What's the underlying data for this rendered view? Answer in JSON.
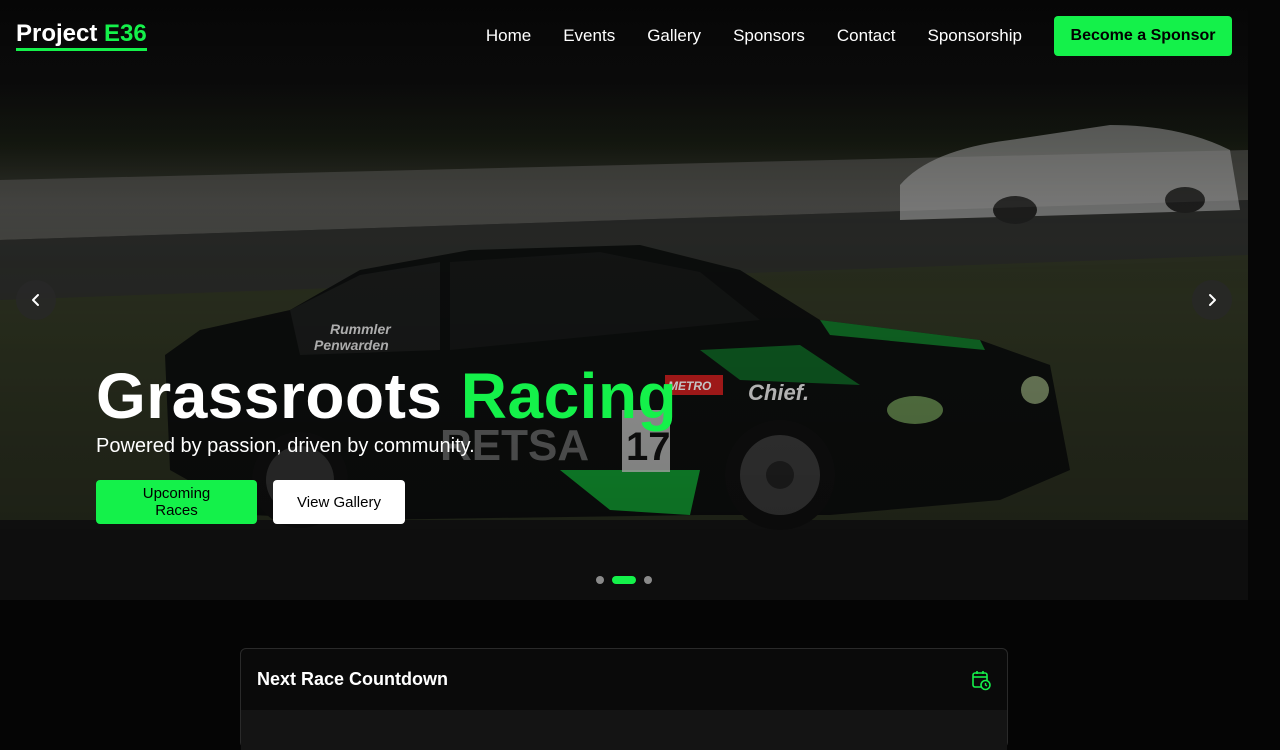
{
  "brand": {
    "word1": "Project",
    "word2": "E36"
  },
  "nav": {
    "items": [
      {
        "label": "Home"
      },
      {
        "label": "Events"
      },
      {
        "label": "Gallery"
      },
      {
        "label": "Sponsors"
      },
      {
        "label": "Contact"
      },
      {
        "label": "Sponsorship"
      }
    ],
    "cta_label": "Become a Sponsor"
  },
  "hero": {
    "headline_part1": "Grassroots",
    "headline_part2": "Racing",
    "tagline": "Powered by passion, driven by community.",
    "primary_button": "Upcoming Races",
    "secondary_button": "View Gallery",
    "slides": 3,
    "active_slide": 2,
    "car": {
      "driver1": "Rummler",
      "driver2": "Penwarden",
      "number": "17",
      "sponsor1": "RETSA",
      "sponsor2": "Chief.",
      "sponsor3": "METRO"
    }
  },
  "countdown": {
    "title": "Next Race Countdown",
    "icon": "calendar-clock-icon"
  },
  "colors": {
    "accent": "#14f14a",
    "background": "#050505"
  }
}
